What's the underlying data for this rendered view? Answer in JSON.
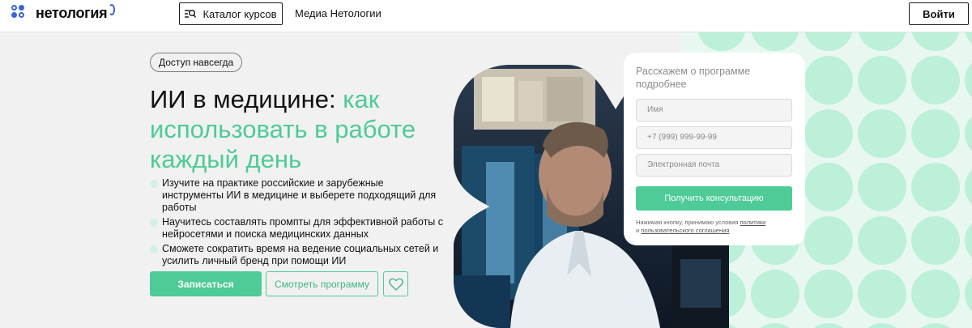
{
  "header": {
    "logo_text": "нетология",
    "catalog_label": "Каталог курсов",
    "media_label": "Медиа Нетологии",
    "login_label": "Войти"
  },
  "hero": {
    "badge": "Доступ навсегда",
    "title_dark": "ИИ в медицине: ",
    "title_accent": "как использовать в работе каждый день",
    "bullets": [
      "Изучите на практике российские и зарубежные инструменты ИИ в медицине и выберете подходящий для работы",
      "Научитесь составлять промпты для эффективной работы с нейросетями и поиска медицинских данных",
      "Сможете сократить время на ведение социальных сетей и усилить личный бренд при помощи ИИ"
    ],
    "enroll_label": "Записаться",
    "program_label": "Смотреть программу",
    "favorite_icon": "heart-icon"
  },
  "form": {
    "title": "Расскажем о программе подробнее",
    "name_placeholder": "Имя",
    "phone_placeholder": "+7 (999) 999-99-99",
    "email_placeholder": "Электронная почта",
    "submit_label": "Получить консультацию",
    "consent_prefix": "Нажимая кнопку, принимаю условия ",
    "policy_link": "политики",
    "consent_and": "и ",
    "agreement_link": "пользовательского соглашения"
  },
  "colors": {
    "accent": "#4ecb97",
    "accent_light": "#d4f0e3",
    "background": "#f1f1f1"
  }
}
